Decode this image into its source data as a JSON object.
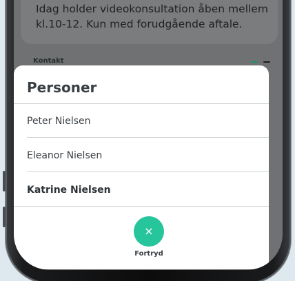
{
  "background": {
    "message": "Idag holder videokonsultation åben mellem kl.10-12. Kun med forudgående aftale.",
    "section_label": "Kontakt"
  },
  "sheet": {
    "title": "Personer",
    "persons": [
      {
        "name": "Peter Nielsen",
        "selected": false
      },
      {
        "name": "Eleanor Nielsen",
        "selected": false
      },
      {
        "name": "Katrine Nielsen",
        "selected": true
      }
    ],
    "cancel": {
      "icon": "close-icon",
      "glyph": "×",
      "label": "Fortryd"
    }
  },
  "colors": {
    "accent": "#27c59b",
    "overlay": "#6f7173",
    "sheet": "#ffffff",
    "text_dark": "#3a3f44"
  }
}
